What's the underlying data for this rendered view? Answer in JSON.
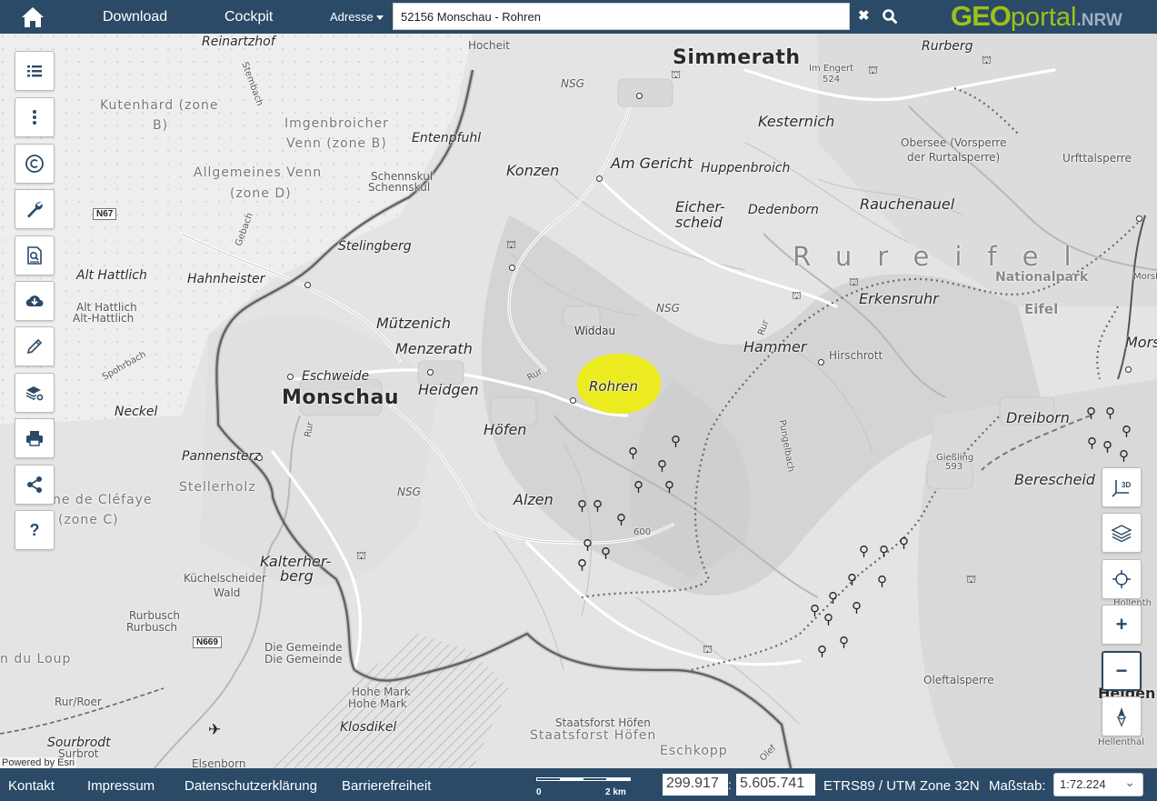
{
  "header": {
    "nav": {
      "download": "Download",
      "cockpit": "Cockpit"
    },
    "search": {
      "mode_label": "Adresse",
      "value": "52156 Monschau - Rohren",
      "clear_symbol": "✖"
    },
    "logo": {
      "geo": "GEO",
      "portal": "portal",
      "nrw": ".NRW"
    }
  },
  "map": {
    "powered_by": "Powered by Esri",
    "highlight_label": "Rohren",
    "places_major": [
      {
        "name": "Simmerath"
      },
      {
        "name": "Monschau"
      }
    ],
    "places": [
      "Kesternich",
      "Konzen",
      "Am Gericht",
      "Huppenbroich",
      "Eicher-",
      "scheid",
      "Dedenborn",
      "Rauchenauel",
      "Erkensruhr",
      "Hammer",
      "Hirschrott",
      "Widdau",
      "Mützenich",
      "Menzerath",
      "Eschweide",
      "Heidgen",
      "Höfen",
      "Alzen",
      "Kalterher-",
      "berg",
      "Entenpfuhl",
      "Stelingberg",
      "Hahnheister",
      "Alt Hattlich",
      "Neckel",
      "Pannensterz",
      "Klosdikel",
      "Dreiborn",
      "Berescheid",
      "Rurberg",
      "Eschkopp",
      "Reinartzhof",
      "Sourbrodt"
    ],
    "areas": [
      "Kutenhard (zone",
      "B)",
      "Imgenbroicher",
      "Venn (zone B)",
      "Allgemeines Venn",
      "(zone D)",
      "Schennskul",
      "Schennskul",
      "Alt Hattlich",
      "Alt-Hattlich",
      "Stellerholz",
      "ne de Cléfaye",
      "(zone C)",
      "Küchelscheider",
      "Wald",
      "Rurbusch",
      "Rurbusch",
      "Die Gemeinde",
      "Die Gemeinde",
      "Hohe Mark",
      "Hohe Mark",
      "Staatsforst Höfen",
      "Staatsforst Höfen",
      "Obersee (Vorsperre",
      "der Rurtalsperre)",
      "Urfttalsperre",
      "Oleftalsperre",
      "Hocheit",
      "Im Engert",
      "Gießling",
      "Hellenthal",
      "n du Loup",
      "Elsenborn",
      "Surbrot",
      "Rur/Roer",
      "Hollenth",
      "Morsbach",
      "Mors",
      "Helden"
    ],
    "small": [
      "NSG",
      "NSG",
      "NSG",
      "524",
      "593",
      "600",
      "Rur",
      "Rur",
      "Rur",
      "Pungelbach",
      "Spohrbach",
      "Gebach",
      "Stembach",
      "Olef"
    ],
    "region": "Rureifel",
    "nationalpark": [
      "Nationalpark",
      "Eifel"
    ],
    "roads": [
      "N67",
      "N669"
    ]
  },
  "tools_left": [
    {
      "name": "legend",
      "icon": "list-icon"
    },
    {
      "name": "more",
      "icon": "vertical-dots-icon"
    },
    {
      "name": "copyright",
      "icon": "copyright-icon"
    },
    {
      "name": "tools",
      "icon": "wrench-icon"
    },
    {
      "name": "search-doc",
      "icon": "document-search-icon"
    },
    {
      "name": "cloud-download",
      "icon": "cloud-download-icon"
    },
    {
      "name": "draw",
      "icon": "pencil-icon"
    },
    {
      "name": "layer-settings",
      "icon": "layers-gear-icon"
    },
    {
      "name": "print",
      "icon": "printer-icon"
    },
    {
      "name": "share",
      "icon": "share-icon"
    },
    {
      "name": "help",
      "icon": "question-icon",
      "label": "?"
    }
  ],
  "controls_right": {
    "view3d_label": "3D",
    "zoom_in": "+",
    "zoom_out": "−"
  },
  "footer": {
    "links": [
      "Kontakt",
      "Impressum",
      "Datenschutzerklärung",
      "Barrierefreiheit"
    ],
    "scale_start": "0",
    "scale_end": "2 km",
    "coord_x": "299.917",
    "coord_sep": ":",
    "coord_y": "5.605.741",
    "crs": "ETRS89 / UTM Zone 32N",
    "scale_label": "Maßstab:",
    "scale_value": "1:72.224"
  },
  "colors": {
    "header_bg": "#2b4a67",
    "logo_green": "#9cc21a",
    "highlight": "#eeee00"
  }
}
